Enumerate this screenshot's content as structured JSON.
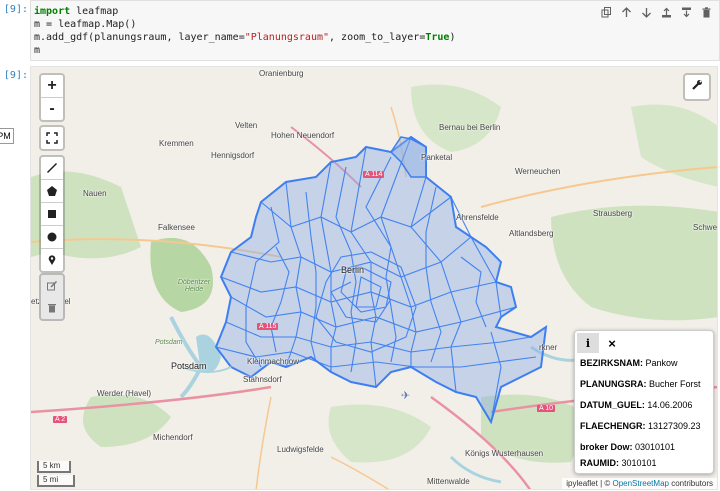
{
  "cell": {
    "prompt_in": "[9]:",
    "prompt_out": "[9]:",
    "code_line1_kw": "import",
    "code_line1_rest": " leafmap",
    "code_line2": "m = leafmap.Map()",
    "code_line3_a": "m.add_gdf(planungsraum, layer_name=",
    "code_line3_str": "\"Planungsraum\"",
    "code_line3_b": ", zoom_to_layer=",
    "code_line3_kw": "True",
    "code_line3_c": ")",
    "code_line4": "m"
  },
  "left_tip": "PM",
  "map": {
    "zoom_in": "+",
    "zoom_out": "-",
    "places": {
      "oranienburg": "Oranienburg",
      "bernau": "Bernau bei Berlin",
      "velten": "Velten",
      "hohen": "Hohen Neuendorf",
      "kremmen": "Kremmen",
      "hennigsdorf": "Hennigsdorf",
      "panketal": "Panketal",
      "werneuchen": "Werneuchen",
      "nauen": "Nauen",
      "falkensee": "Falkensee",
      "ahrensfelde": "Ahrensfelde",
      "altlandsberg": "Altlandsberg",
      "strausberg": "Strausberg",
      "schwedt": "Schwe",
      "berlin": "Berlin",
      "ketzin": "etzin/Havel",
      "doberitzer": "Döberitzer Heide",
      "potsdam_small": "Potsdam",
      "potsdam": "Potsdam",
      "kleinmachnow": "Kleinmachnow",
      "stahnsdorf": "Stahnsdorf",
      "werder": "Werder (Havel)",
      "michendorf": "Michendorf",
      "ludwigsfelde": "Ludwigsfelde",
      "konigs": "Königs Wusterhausen",
      "mittenwalde": "Mittenwalde",
      "erkner": "rkner",
      "a114": "A 114",
      "a115": "A 115",
      "a2": "A 2",
      "a10": "A 10"
    },
    "scale_km": "5 km",
    "scale_mi": "5 mi",
    "attribution_prefix": "ipyleaflet | © ",
    "attribution_link": "OpenStreetMap",
    "attribution_suffix": " contributors"
  },
  "popup": {
    "info_icon": "i",
    "close_icon": "×",
    "rows": [
      {
        "key": "BEZIRKSNAM:",
        "value": " Pankow"
      },
      {
        "key": "PLANUNGSRA:",
        "value": " Bucher Forst"
      },
      {
        "key": "DATUM_GUEL:",
        "value": " 14.06.2006"
      },
      {
        "key": "FLAECHENGR:",
        "value": " 13127309.23"
      },
      {
        "key": "broker Dow:",
        "value": " 03010101"
      },
      {
        "key": "RAUMID:",
        "value": " 3010101"
      }
    ]
  },
  "colors": {
    "polygon_stroke": "#3d7ff0",
    "polygon_fill": "#8fb0e6",
    "forest": "#b6d6a3",
    "water": "#aad3df",
    "link": "#0078a8"
  }
}
